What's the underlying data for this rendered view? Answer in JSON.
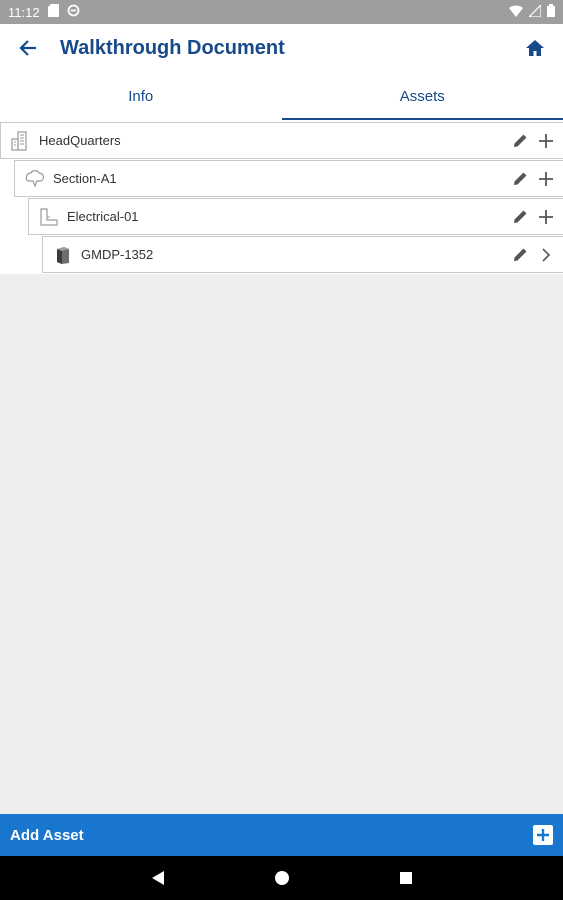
{
  "status_bar": {
    "time": "11:12"
  },
  "app_bar": {
    "title": "Walkthrough Document"
  },
  "tabs": [
    {
      "label": "Info",
      "active": false
    },
    {
      "label": "Assets",
      "active": true
    }
  ],
  "tree": [
    {
      "label": "HeadQuarters",
      "icon": "building-icon",
      "trailing": "add"
    },
    {
      "label": "Section-A1",
      "icon": "section-icon",
      "trailing": "add"
    },
    {
      "label": "Electrical-01",
      "icon": "system-icon",
      "trailing": "add"
    },
    {
      "label": "GMDP-1352",
      "icon": "equipment-icon",
      "trailing": "chevron-right"
    }
  ],
  "add_bar": {
    "label": "Add Asset"
  },
  "colors": {
    "brand": "#174a8b",
    "accent": "#1976cf",
    "background": "#eeeeee"
  }
}
